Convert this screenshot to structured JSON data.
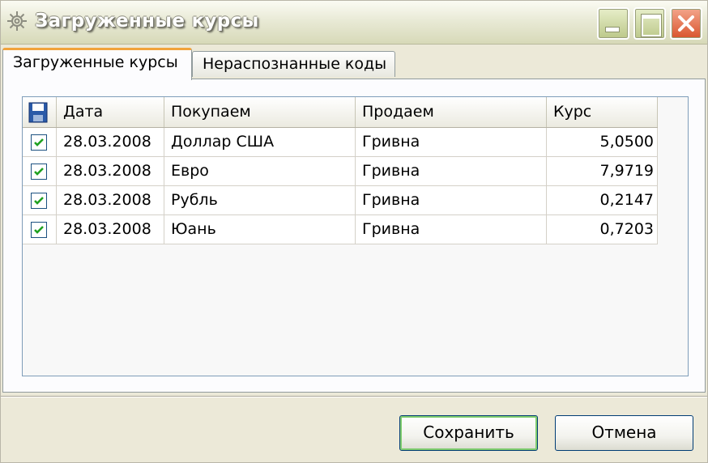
{
  "window": {
    "title": "Загруженные курсы"
  },
  "tabs": [
    {
      "label": "Загруженные курсы",
      "active": true
    },
    {
      "label": "Нераспознанные коды",
      "active": false
    }
  ],
  "grid": {
    "columns": [
      "Дата",
      "Покупаем",
      "Продаем",
      "Курс"
    ],
    "rows": [
      {
        "checked": true,
        "date": "28.03.2008",
        "buy": "Доллар США",
        "sell": "Гривна",
        "rate": "5,0500"
      },
      {
        "checked": true,
        "date": "28.03.2008",
        "buy": "Евро",
        "sell": "Гривна",
        "rate": "7,9719"
      },
      {
        "checked": true,
        "date": "28.03.2008",
        "buy": "Рубль",
        "sell": "Гривна",
        "rate": "0,2147"
      },
      {
        "checked": true,
        "date": "28.03.2008",
        "buy": "Юань",
        "sell": "Гривна",
        "rate": "0,7203"
      }
    ]
  },
  "buttons": {
    "save_label": "Сохранить",
    "cancel_label": "Отмена"
  },
  "icons": {
    "title": "gear-icon",
    "header": "floppy-disk-icon",
    "row": "checkbox-checked-icon"
  },
  "colors": {
    "tab_accent": "#f1a33c",
    "check": "#21a121",
    "close_button": "#d9552e"
  }
}
